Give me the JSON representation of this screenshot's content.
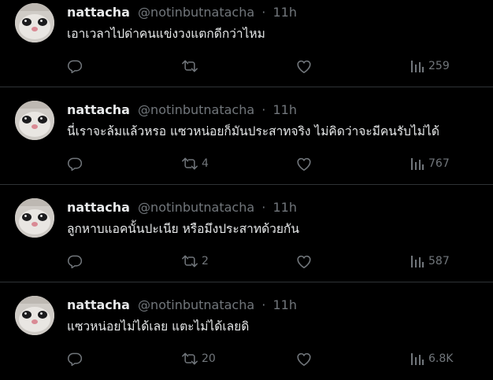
{
  "colors": {
    "background": "#000000",
    "text_primary": "#e7e9ea",
    "text_secondary": "#71767b",
    "divider": "#2f3336"
  },
  "tweets": [
    {
      "display_name": "nattacha",
      "handle": "@notinbutnatacha",
      "separator": "·",
      "time": "11h",
      "text": "เอาเวลาไปด่าคนแข่งวงแตกดีกว่าไหม",
      "replies": "",
      "retweets": "",
      "likes": "",
      "views": "259",
      "icons": [
        "reply-icon",
        "retweet-icon",
        "like-icon",
        "views-icon"
      ]
    },
    {
      "display_name": "nattacha",
      "handle": "@notinbutnatacha",
      "separator": "·",
      "time": "11h",
      "text": "นี่เราจะล้มแล้วหรอ แซวหน่อยก็มันประสาทจริง ไม่คิดว่าจะมีคนรับไม่ได้",
      "replies": "",
      "retweets": "4",
      "likes": "",
      "views": "767",
      "icons": [
        "reply-icon",
        "retweet-icon",
        "like-icon",
        "views-icon"
      ]
    },
    {
      "display_name": "nattacha",
      "handle": "@notinbutnatacha",
      "separator": "·",
      "time": "11h",
      "text": "ลูกหาบแอคนั้นปะเนีย หรือมึงประสาทด้วยกัน",
      "replies": "",
      "retweets": "2",
      "likes": "",
      "views": "587",
      "icons": [
        "reply-icon",
        "retweet-icon",
        "like-icon",
        "views-icon"
      ]
    },
    {
      "display_name": "nattacha",
      "handle": "@notinbutnatacha",
      "separator": "·",
      "time": "11h",
      "text": "แซวหน่อยไม่ได้เลย แตะไม่ได้เลยดิ",
      "replies": "",
      "retweets": "20",
      "likes": "",
      "views": "6.8K",
      "icons": [
        "reply-icon",
        "retweet-icon",
        "like-icon",
        "views-icon"
      ]
    }
  ]
}
